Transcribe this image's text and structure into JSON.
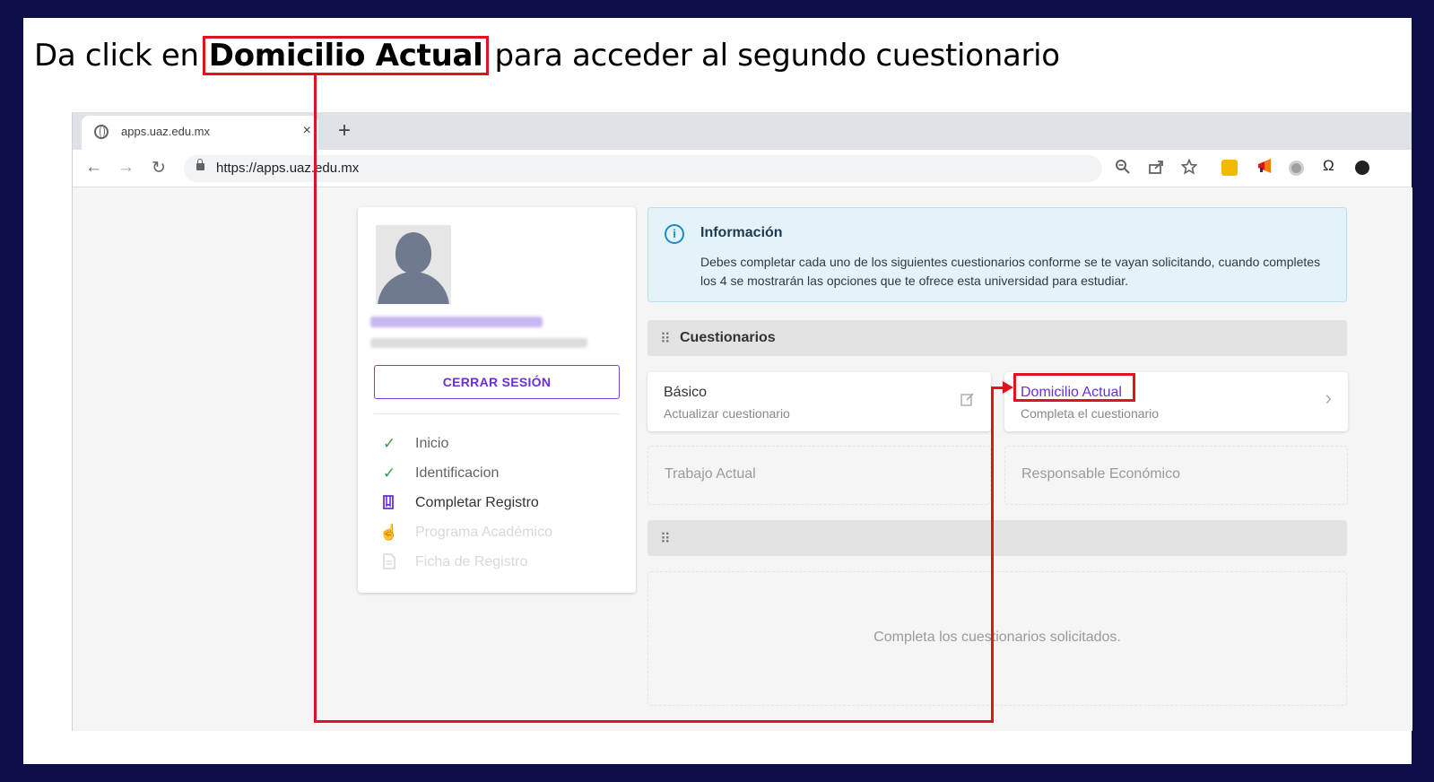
{
  "slide": {
    "instruction_prefix": "Da click en",
    "instruction_highlight": "Domicilio Actual",
    "instruction_suffix": "para acceder al segundo cuestionario"
  },
  "browser": {
    "tab_title": "apps.uaz.edu.mx",
    "tab_close": "×",
    "new_tab": "+",
    "url": "https://apps.uaz.edu.mx",
    "back": "←",
    "forward": "→",
    "reload": "↻"
  },
  "profile": {
    "logout_label": "CERRAR SESIÓN"
  },
  "steps": [
    {
      "label": "Inicio",
      "icon": "check-icon",
      "state": "done"
    },
    {
      "label": "Identificacion",
      "icon": "check-icon",
      "state": "done"
    },
    {
      "label": "Completar Registro",
      "icon": "book-icon",
      "state": "active"
    },
    {
      "label": "Programa Académico",
      "icon": "hand-pointer-icon",
      "state": "disabled"
    },
    {
      "label": "Ficha de Registro",
      "icon": "document-icon",
      "state": "disabled"
    }
  ],
  "info": {
    "title": "Información",
    "body": "Debes completar cada uno de los siguientes cuestionarios conforme se te vayan solicitando, cuando completes los 4 se mostrarán las opciones que te ofrece esta universidad para estudiar."
  },
  "questionnaires": {
    "header": "Cuestionarios",
    "basico": {
      "title": "Básico",
      "subtitle": "Actualizar cuestionario"
    },
    "domicilio": {
      "title": "Domicilio Actual",
      "subtitle": "Completa el cuestionario"
    },
    "trabajo": {
      "title": "Trabajo Actual"
    },
    "responsable": {
      "title": "Responsable Económico"
    }
  },
  "second_section": {
    "empty_message": "Completa los cuestionarios solicitados."
  },
  "colors": {
    "slide_border": "#0c0f4a",
    "highlight_red": "#e0141e",
    "accent_purple": "#6a2fd6",
    "info_blue": "#1e88c8",
    "check_green": "#2e9e4a"
  }
}
